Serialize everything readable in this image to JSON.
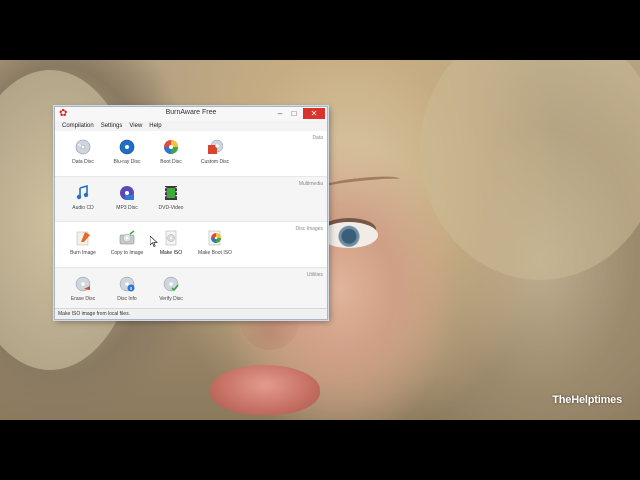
{
  "window": {
    "title": "BurnAware Free",
    "controls": {
      "minimize": "–",
      "maximize": "□",
      "close": "✕"
    }
  },
  "menubar": {
    "items": [
      {
        "label": "Compilation"
      },
      {
        "label": "Settings"
      },
      {
        "label": "View"
      },
      {
        "label": "Help"
      }
    ]
  },
  "sections": [
    {
      "label": "Data",
      "items": [
        {
          "label": "Data Disc",
          "icon": "data-disc-icon"
        },
        {
          "label": "Blu-ray Disc",
          "icon": "bluray-disc-icon"
        },
        {
          "label": "Boot Disc",
          "icon": "boot-disc-icon"
        },
        {
          "label": "Custom Disc",
          "icon": "custom-disc-icon"
        }
      ]
    },
    {
      "label": "Multimedia",
      "items": [
        {
          "label": "Audio CD",
          "icon": "audio-cd-icon"
        },
        {
          "label": "MP3 Disc",
          "icon": "mp3-disc-icon"
        },
        {
          "label": "DVD-Video",
          "icon": "dvd-video-icon"
        }
      ]
    },
    {
      "label": "Disc Images",
      "items": [
        {
          "label": "Burn Image",
          "icon": "burn-image-icon"
        },
        {
          "label": "Copy to Image",
          "icon": "copy-to-image-icon"
        },
        {
          "label": "Make ISO",
          "icon": "make-iso-icon"
        },
        {
          "label": "Make Boot ISO",
          "icon": "make-boot-iso-icon"
        }
      ]
    },
    {
      "label": "Utilities",
      "items": [
        {
          "label": "Erase Disc",
          "icon": "erase-disc-icon"
        },
        {
          "label": "Disc Info",
          "icon": "disc-info-icon"
        },
        {
          "label": "Verify Disc",
          "icon": "verify-disc-icon"
        }
      ]
    }
  ],
  "statusbar": {
    "text": "Make ISO image from local files."
  },
  "watermark": {
    "text": "TheHelptimes"
  },
  "colors": {
    "close": "#d9332b",
    "window_border": "#a6b7c9",
    "accent": "#1f5fbf"
  }
}
